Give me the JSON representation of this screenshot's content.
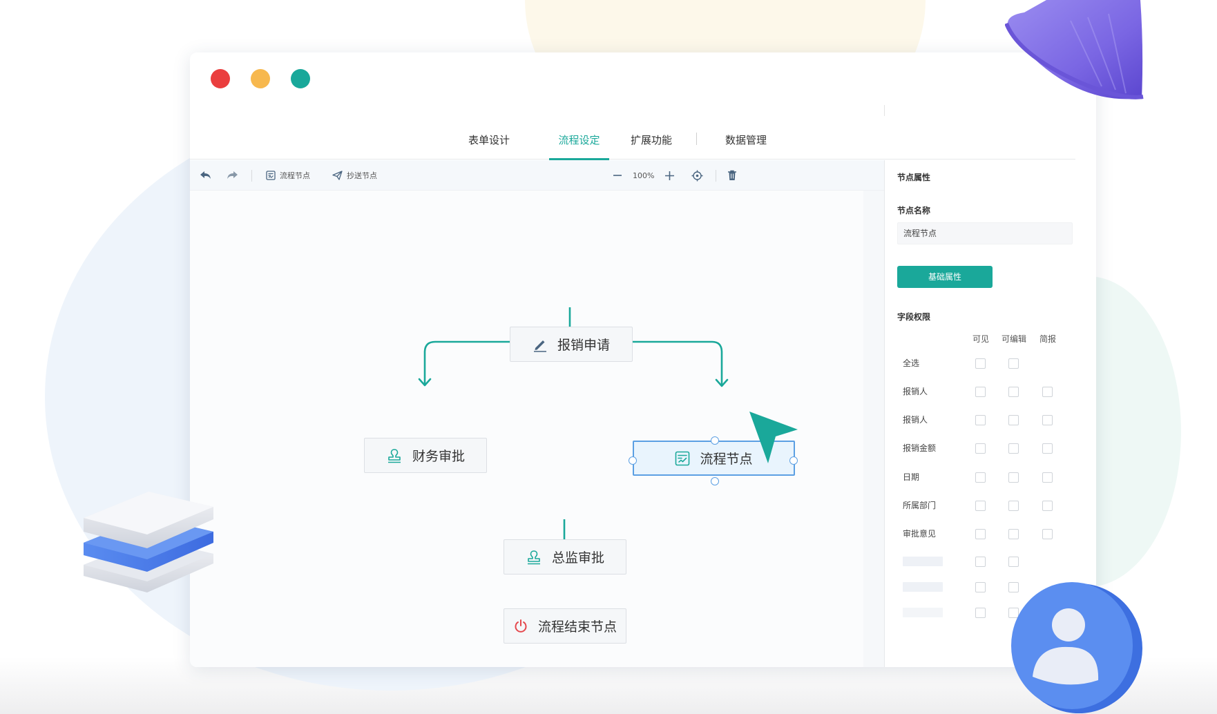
{
  "tabs": [
    {
      "label": "表单设计",
      "active": false
    },
    {
      "label": "流程设定",
      "active": true
    },
    {
      "label": "扩展功能",
      "active": false
    },
    {
      "label": "数据管理",
      "active": false
    }
  ],
  "toolbar": {
    "process_node": "流程节点",
    "cc_node": "抄送节点",
    "zoom": "100%"
  },
  "flow": {
    "nodes": {
      "apply": "报销申请",
      "finance": "财务审批",
      "process": "流程节点",
      "director": "总监审批",
      "end": "流程结束节点"
    },
    "selected_node": "process"
  },
  "panel": {
    "title": "节点属性",
    "name_label": "节点名称",
    "name_value": "流程节点",
    "basic_button": "基础属性",
    "field_section": "字段权限",
    "columns": [
      "可见",
      "可编辑",
      "简报"
    ],
    "rows": [
      {
        "label": "全选"
      },
      {
        "label": "报销人"
      },
      {
        "label": "报销人"
      },
      {
        "label": "报销金额"
      },
      {
        "label": "日期"
      },
      {
        "label": "所属部门"
      },
      {
        "label": "审批意见"
      }
    ]
  },
  "colors": {
    "accent": "#1aa89a",
    "selected_border": "#5b9fe3",
    "end_icon": "#e5484d",
    "window_red": "#ea3e3e",
    "window_yellow": "#f7b84e",
    "window_green": "#19a89a"
  }
}
